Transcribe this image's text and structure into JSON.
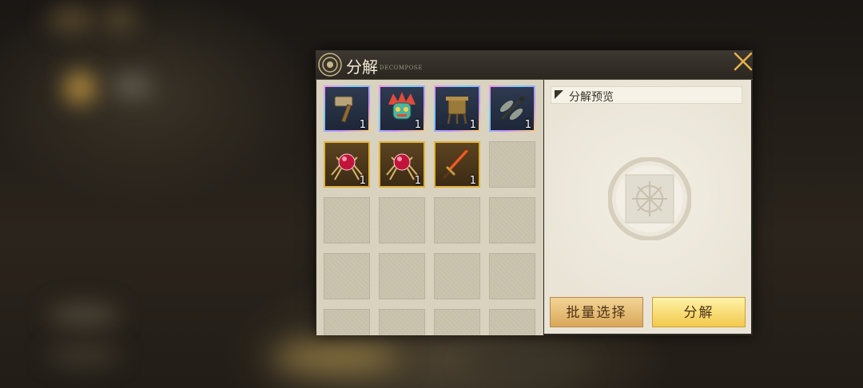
{
  "dialog": {
    "title": "分解",
    "subtitle": "DECOMPOSE"
  },
  "inventory": {
    "items": [
      {
        "icon": "hammer-icon",
        "rarity": "purple",
        "qty": "1"
      },
      {
        "icon": "tribal-mask-icon",
        "rarity": "purple",
        "qty": "1"
      },
      {
        "icon": "bronze-vessel-icon",
        "rarity": "purple",
        "qty": "1"
      },
      {
        "icon": "dragonfly-icon",
        "rarity": "purple",
        "qty": "1"
      },
      {
        "icon": "red-gem-spider-icon",
        "rarity": "gold",
        "qty": "1"
      },
      {
        "icon": "red-gem-spider-icon",
        "rarity": "gold",
        "qty": "1"
      },
      {
        "icon": "sword-icon",
        "rarity": "gold",
        "qty": "1"
      }
    ],
    "rarity_colors": {
      "purple": "#c38aff",
      "gold": "#e0b23a"
    }
  },
  "preview": {
    "label": "分解预览"
  },
  "buttons": {
    "batch_select": "批量选择",
    "decompose": "分解"
  }
}
